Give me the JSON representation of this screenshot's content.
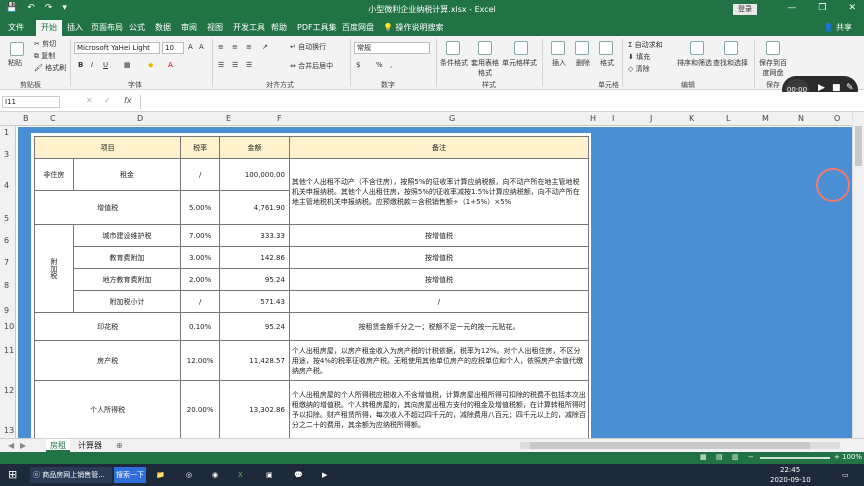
{
  "window": {
    "title": "小型微利企业纳税计算.xlsx - Excel",
    "login_label": "登录",
    "minimize": "—",
    "restore": "❐",
    "close": "✕",
    "share_label": "共享"
  },
  "qat": {
    "save": "💾",
    "undo": "↶",
    "redo": "↷",
    "more": "▾"
  },
  "tabs": [
    "文件",
    "开始",
    "插入",
    "页面布局",
    "公式",
    "数据",
    "审阅",
    "视图",
    "开发工具",
    "帮助",
    "PDF工具集",
    "百度网盘"
  ],
  "active_tab": "开始",
  "tell_me": "操作说明搜索",
  "ribbon": {
    "paste": "粘贴",
    "cut": "剪切",
    "copy": "复制",
    "format_painter": "格式刷",
    "clipboard_group": "剪贴板",
    "font_name": "Microsoft YaHei Light",
    "font_size": "10",
    "bold": "B",
    "italic": "I",
    "underline": "U",
    "font_group": "字体",
    "wrap_text": "自动换行",
    "merge_center": "合并后居中",
    "align_group": "对齐方式",
    "number_format": "常规",
    "percent": "%",
    "comma": ",",
    "number_group": "数字",
    "conditional_format": "条件格式",
    "format_as_table": "套用表格格式",
    "cell_styles": "单元格样式",
    "styles_group": "样式",
    "insert": "插入",
    "delete": "删除",
    "format": "格式",
    "cells_group": "单元格",
    "autosum": "自动求和",
    "fill": "填充",
    "clear": "清除",
    "sort_filter": "排序和筛选",
    "find_select": "查找和选择",
    "editing_group": "编辑",
    "save_baidu": "保存到百度网盘",
    "save_group": "保存"
  },
  "recorder": {
    "time": "00:00"
  },
  "formula_bar": {
    "name_box": "I11",
    "fx": "fx",
    "value": ""
  },
  "columns": [
    "B",
    "C",
    "D",
    "E",
    "F",
    "G",
    "H",
    "I",
    "J",
    "K",
    "L",
    "M",
    "N",
    "O"
  ],
  "rows": [
    "1",
    "3",
    "4",
    "5",
    "6",
    "7",
    "8",
    "9",
    "10",
    "11",
    "12",
    "13"
  ],
  "table": {
    "headers": [
      "项目",
      "税率",
      "金额",
      "备注"
    ],
    "rent_group": "非住房",
    "rent_item": "租金",
    "rent_rate": "/",
    "rent_amount": "100,000.00",
    "vat_note": "其他个人出租不动产（不含住房），按照5%的征收率计算应纳税额，向不动产所在地主管地税机关申报纳税。其他个人出租住房，按照5%的征收率减按1.5%计算应纳税额，向不动产所在地主管地税机关申报纳税。应预缴税款＝含税销售额÷（1+5%）×5%",
    "vat_item": "增值税",
    "vat_rate": "5.00%",
    "vat_amount": "4,761.90",
    "surtax_group": "附加税",
    "urban_item": "城市建设维护税",
    "urban_rate": "7.00%",
    "urban_amount": "333.33",
    "urban_note": "按增值税",
    "edu_item": "教育费附加",
    "edu_rate": "3.00%",
    "edu_amount": "142.86",
    "edu_note": "按增值税",
    "local_edu_item": "地方教育费附加",
    "local_edu_rate": "2.00%",
    "local_edu_amount": "95.24",
    "local_edu_note": "按增值税",
    "subtotal_item": "附加税小计",
    "subtotal_rate": "/",
    "subtotal_amount": "571.43",
    "subtotal_note": "/",
    "stamp_item": "印花税",
    "stamp_rate": "0.10%",
    "stamp_amount": "95.24",
    "stamp_note": "按租赁金额千分之一；税额不足一元的按一元贴花。",
    "property_item": "房产税",
    "property_rate": "12.00%",
    "property_amount": "11,428.57",
    "property_note": "个人出租房屋，以房产租金收入为房产税的计税依据，税率为12%。对个人出租住房，不区分用途，按4%的税率征收房产税。无租使用其他单位房产的应税单位和个人，依照房产余值代缴纳房产税。",
    "income_item": "个人所得税",
    "income_rate": "20.00%",
    "income_amount": "13,302.86",
    "income_note": "个人出租房屋的个人所得税应税收入不含增值税，计算房屋出租所得可扣除的税费不包括本次出租缴纳的增值税。个人转租房屋的，其向房屋出租方支付的租金及增值税额，在计算转租所得时予以扣除。财产租赁所得，每次收入不超过四千元的，减除费用八百元；四千元以上的，减除百分之二十的费用，其余额为应纳税所得额。"
  },
  "sheets": [
    "房租",
    "计算器"
  ],
  "active_sheet": "房租",
  "status": {
    "zoom": "100%"
  },
  "taskbar": {
    "search": "搜索一下",
    "app_title": "商品房网上销售管...",
    "time": "22:45",
    "date": "2020-09-10"
  }
}
